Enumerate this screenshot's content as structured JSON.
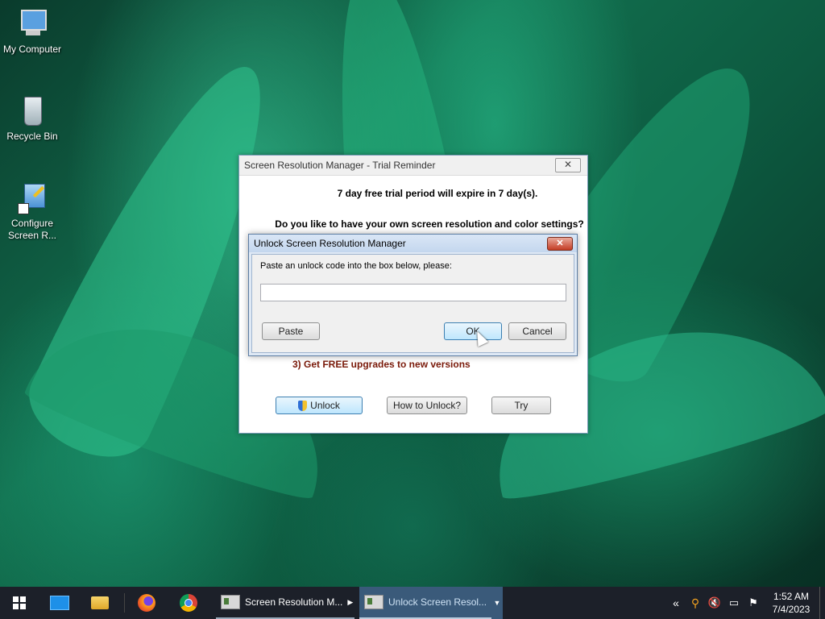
{
  "desktop": {
    "icons": [
      {
        "label": "My Computer"
      },
      {
        "label": "Recycle Bin"
      },
      {
        "label": "Configure Screen R..."
      }
    ]
  },
  "trial_dialog": {
    "title": "Screen Resolution Manager - Trial Reminder",
    "close_label": "✕",
    "expire_text": "7 day free trial period will expire in 7 day(s).",
    "question_text": "Do you like to have your own screen resolution and color settings?",
    "benefit_3": "3) Get FREE upgrades to new versions",
    "buttons": {
      "unlock": "Unlock",
      "how_to": "How to Unlock?",
      "try": "Try"
    }
  },
  "unlock_dialog": {
    "title": "Unlock Screen Resolution Manager",
    "close_label": "✕",
    "prompt": "Paste an unlock code into the box below, please:",
    "code_value": "",
    "buttons": {
      "paste": "Paste",
      "ok": "OK",
      "cancel": "Cancel"
    }
  },
  "taskbar": {
    "tasks": [
      {
        "label": "Screen Resolution M..."
      },
      {
        "label": "Unlock Screen Resol..."
      }
    ],
    "clock": {
      "time": "1:52 AM",
      "date": "7/4/2023"
    }
  },
  "colors": {
    "taskbar": "#1c2029",
    "heading_red": "#7a1a0a",
    "default_button": "#bee6fd"
  }
}
